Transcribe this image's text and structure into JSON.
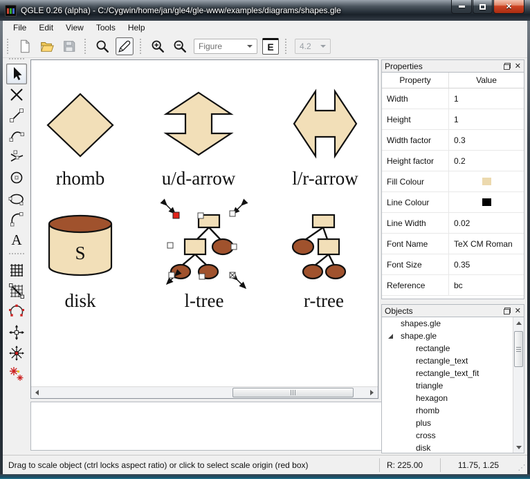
{
  "window": {
    "title": "QGLE 0.26 (alpha) - C:/Cygwin/home/jan/gle4/gle-www/examples/diagrams/shapes.gle"
  },
  "menu": {
    "items": [
      "File",
      "Edit",
      "View",
      "Tools",
      "Help"
    ]
  },
  "toolbar": {
    "figure_dropdown_value": "Figure",
    "equation_button_label": "E",
    "version_dropdown_value": "4.2"
  },
  "left_tools": [
    {
      "name": "select-tool",
      "selected": true
    },
    {
      "name": "delete-tool"
    },
    {
      "name": "line-tool"
    },
    {
      "name": "curve-tool"
    },
    {
      "name": "spline-tool"
    },
    {
      "name": "circle-tool"
    },
    {
      "name": "ellipse-tool"
    },
    {
      "name": "arc-tool"
    },
    {
      "name": "text-tool"
    },
    {
      "name": "grid-tool",
      "section": 2
    },
    {
      "name": "grid-snap-tool"
    },
    {
      "name": "rotate-tool"
    },
    {
      "name": "move-tool"
    },
    {
      "name": "scale-tool"
    },
    {
      "name": "perspective-tool"
    }
  ],
  "canvas": {
    "shapes": [
      {
        "name": "rhomb",
        "label": "rhomb"
      },
      {
        "name": "ud-arrow",
        "label": "u/d-arrow"
      },
      {
        "name": "lr-arrow",
        "label": "l/r-arrow"
      },
      {
        "name": "disk",
        "label": "disk"
      },
      {
        "name": "l-tree",
        "label": "l-tree"
      },
      {
        "name": "r-tree",
        "label": "r-tree"
      }
    ],
    "disk_letter": "S"
  },
  "colors": {
    "shape_fill": "#f2dfb8",
    "shape_brown": "#a0522d",
    "selection_red": "#e0241b",
    "fill_swatch": "#ecd9ae",
    "line_swatch": "#000000"
  },
  "properties": {
    "title": "Properties",
    "columns": [
      "Property",
      "Value"
    ],
    "rows": [
      {
        "property": "Width",
        "value": "1"
      },
      {
        "property": "Height",
        "value": "1"
      },
      {
        "property": "Width factor",
        "value": "0.3"
      },
      {
        "property": "Height factor",
        "value": "0.2"
      },
      {
        "property": "Fill Colour",
        "swatch": "#ecd9ae"
      },
      {
        "property": "Line Colour",
        "swatch": "#000000"
      },
      {
        "property": "Line Width",
        "value": "0.02"
      },
      {
        "property": "Font Name",
        "value": "TeX CM Roman"
      },
      {
        "property": "Font Size",
        "value": "0.35"
      },
      {
        "property": "Reference",
        "value": "bc"
      }
    ]
  },
  "objects": {
    "title": "Objects",
    "items": [
      {
        "label": "shapes.gle",
        "indent": 0
      },
      {
        "label": "shape.gle",
        "indent": 0,
        "expanded": true
      },
      {
        "label": "rectangle",
        "indent": 1
      },
      {
        "label": "rectangle_text",
        "indent": 1
      },
      {
        "label": "rectangle_text_fit",
        "indent": 1
      },
      {
        "label": "triangle",
        "indent": 1
      },
      {
        "label": "hexagon",
        "indent": 1
      },
      {
        "label": "rhomb",
        "indent": 1
      },
      {
        "label": "plus",
        "indent": 1
      },
      {
        "label": "cross",
        "indent": 1
      },
      {
        "label": "disk",
        "indent": 1
      }
    ]
  },
  "status": {
    "message": "Drag to scale object (ctrl locks aspect ratio) or click to select scale origin (red box)",
    "r_value": "R:  225.00",
    "coords": "11.75, 1.25"
  }
}
